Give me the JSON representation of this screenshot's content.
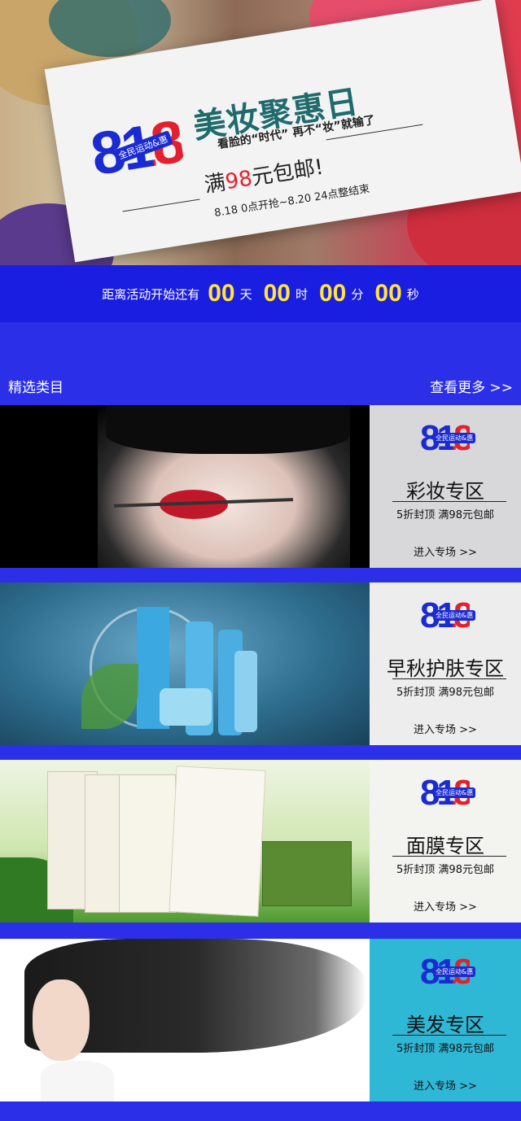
{
  "hero": {
    "logo_number": "818",
    "logo_badge": "全民运动&惠",
    "title": "美妆聚惠日",
    "subtitle": "看脸的“时代” 再不“妆”就输了",
    "promo_prefix": "满",
    "promo_amount": "98",
    "promo_suffix": "元包邮!",
    "date": "8.18 0点开抢~8.20 24点整结束",
    "colors": {
      "card": "#f3f3f4",
      "blue": "#1a2bd1",
      "red": "#e3212e",
      "title": "#1f6b6c"
    }
  },
  "countdown": {
    "prefix": "距离活动开始还有",
    "days": "00",
    "days_unit": "天",
    "hours": "00",
    "hours_unit": "时",
    "minutes": "00",
    "minutes_unit": "分",
    "seconds": "00",
    "seconds_unit": "秒",
    "number_color": "#ffe53b"
  },
  "section": {
    "title": "精选类目",
    "more": "查看更多  >>"
  },
  "categories": [
    {
      "title": "彩妆专区",
      "desc": "5折封顶    满98元包邮",
      "link": "进入专场  >>",
      "panel_color": "#d8d8da",
      "icon": "lipstick-model-image"
    },
    {
      "title": "早秋护肤专区",
      "desc": "5折封顶    满98元包邮",
      "link": "进入专场  >>",
      "panel_color": "#ededee",
      "icon": "skincare-bottles-image"
    },
    {
      "title": "面膜专区",
      "desc": "5折封顶    满98元包邮",
      "link": "进入专场  >>",
      "panel_color": "#f3f4f0",
      "icon": "face-mask-boxes-image"
    },
    {
      "title": "美发专区",
      "desc": "5折封顶    满98元包邮",
      "link": "进入专场  >>",
      "panel_color": "#2fb8d6",
      "icon": "long-hair-model-image"
    }
  ],
  "logo_number": "818",
  "logo_badge": "全民运动&惠",
  "page_background": "#2b2fe8"
}
